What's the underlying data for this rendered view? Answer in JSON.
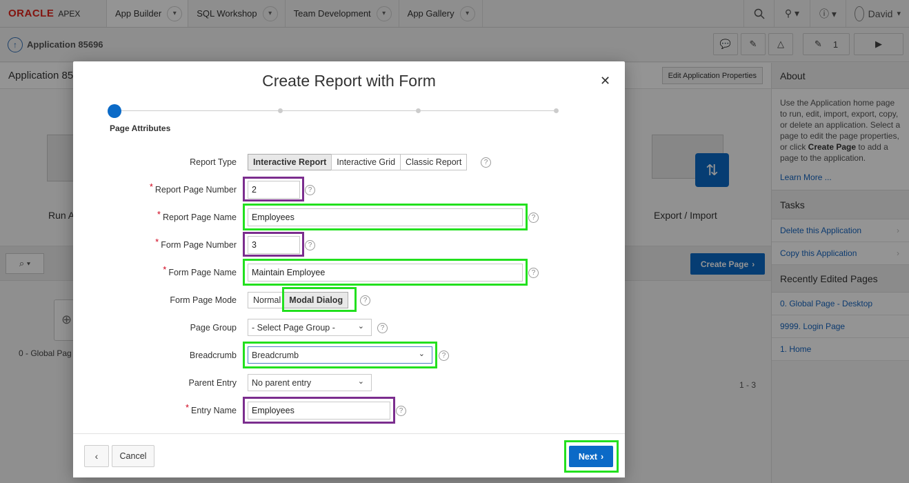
{
  "nav": {
    "brand": "ORACLE",
    "product": "APEX",
    "tabs": [
      "App Builder",
      "SQL Workshop",
      "Team Development",
      "App Gallery"
    ],
    "user": "David"
  },
  "subheader": {
    "app_title": "Application 85696",
    "edit_count": "1"
  },
  "main": {
    "title": "Application 85",
    "edit_props": "Edit Application Properties",
    "run_label": "Run A",
    "export_label": "Export / Import",
    "create_page": "Create Page",
    "page_label": "0 - Global Pag",
    "count": "1 - 3"
  },
  "sidebar": {
    "about_title": "About",
    "about_text_1": "Use the Application home page to run, edit, import, export, copy, or delete an application. Select a page to edit the page properties, or click ",
    "about_bold": "Create Page",
    "about_text_2": " to add a page to the application.",
    "learn_more": "Learn More ...",
    "tasks_title": "Tasks",
    "tasks": [
      "Delete this Application",
      "Copy this Application"
    ],
    "recent_title": "Recently Edited Pages",
    "recent": [
      "0. Global Page - Desktop",
      "9999. Login Page",
      "1. Home"
    ]
  },
  "dialog": {
    "title": "Create Report with Form",
    "step_label": "Page Attributes",
    "fields": {
      "report_type_label": "Report Type",
      "report_type_options": [
        "Interactive Report",
        "Interactive Grid",
        "Classic Report"
      ],
      "report_page_number_label": "Report Page Number",
      "report_page_number": "2",
      "report_page_name_label": "Report Page Name",
      "report_page_name": "Employees",
      "form_page_number_label": "Form Page Number",
      "form_page_number": "3",
      "form_page_name_label": "Form Page Name",
      "form_page_name": "Maintain Employee",
      "form_page_mode_label": "Form Page Mode",
      "form_page_mode_options": [
        "Normal",
        "Modal Dialog"
      ],
      "page_group_label": "Page Group",
      "page_group": "- Select Page Group -",
      "breadcrumb_label": "Breadcrumb",
      "breadcrumb": "Breadcrumb",
      "parent_entry_label": "Parent Entry",
      "parent_entry": "No parent entry",
      "entry_name_label": "Entry Name",
      "entry_name": "Employees"
    },
    "cancel": "Cancel",
    "next": "Next"
  },
  "colors": {
    "accent": "#0b6ac7",
    "highlight_green": "#22e01e",
    "highlight_purple": "#7b2d8e",
    "oracle_red": "#e2231a"
  }
}
